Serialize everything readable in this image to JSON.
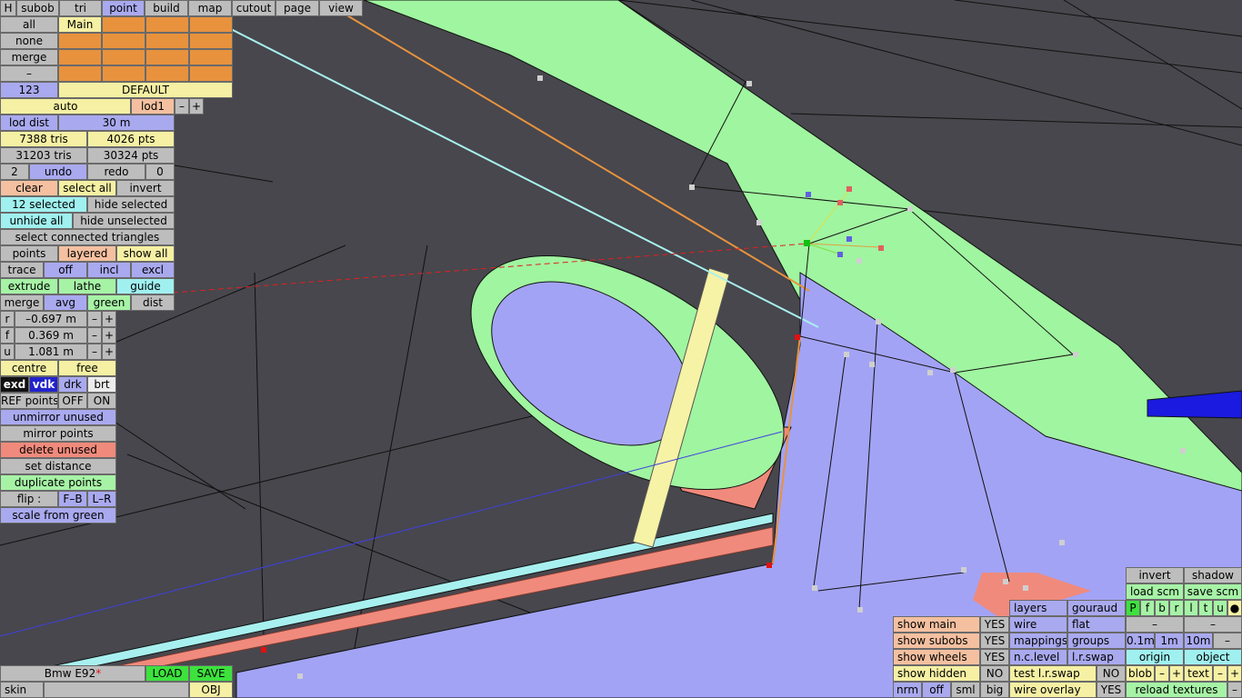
{
  "menu": {
    "h": "H",
    "tabs": [
      "subob",
      "tri",
      "point",
      "build",
      "map",
      "cutout",
      "page",
      "view"
    ],
    "active": "point"
  },
  "layers": {
    "all": "all",
    "none": "none",
    "merge": "merge",
    "dash": "–",
    "main": "Main",
    "num": "123",
    "default": "DEFAULT"
  },
  "lod": {
    "auto": "auto",
    "lod": "lod1",
    "minus": "–",
    "plus": "+",
    "dist_label": "lod dist",
    "dist_value": "30 m"
  },
  "stats": {
    "tris": "7388 tris",
    "pts": "4026 pts",
    "tris_total": "31203 tris",
    "pts_total": "30324 pts"
  },
  "history": {
    "count": "2",
    "undo": "undo",
    "redo": "redo",
    "redo_count": "0"
  },
  "selection": {
    "clear": "clear",
    "select_all": "select all",
    "invert": "invert",
    "selected": "12 selected",
    "hide_selected": "hide selected",
    "unhide_all": "unhide all",
    "hide_unselected": "hide unselected",
    "connected": "select connected triangles"
  },
  "display": {
    "points": "points",
    "layered": "layered",
    "show_all": "show all"
  },
  "trace": {
    "label": "trace",
    "off": "off",
    "incl": "incl",
    "excl": "excl"
  },
  "tools": {
    "extrude": "extrude",
    "lathe": "lathe",
    "guide": "guide"
  },
  "merge_row": {
    "merge": "merge",
    "avg": "avg",
    "green": "green",
    "dist": "dist"
  },
  "coords": [
    {
      "axis": "r",
      "value": "–0.697 m"
    },
    {
      "axis": "f",
      "value": "0.369 m"
    },
    {
      "axis": "u",
      "value": "1.081 m"
    }
  ],
  "stepper": {
    "minus": "–",
    "plus": "+"
  },
  "centre": {
    "centre": "centre",
    "free": "free"
  },
  "render_modes": [
    "exd",
    "vdk",
    "drk",
    "brt"
  ],
  "refpoints": {
    "label": "REF points",
    "off": "OFF",
    "on": "ON"
  },
  "actions": {
    "unmirror": "unmirror unused",
    "mirror": "mirror points",
    "delete": "delete unused",
    "set_distance": "set distance",
    "duplicate": "duplicate points",
    "flip": "flip :",
    "fb": "F–B",
    "lr": "L–R",
    "scale": "scale from green"
  },
  "file": {
    "name": "Bmw E92",
    "modified": "*",
    "load": "LOAD",
    "save": "SAVE",
    "skin": "skin",
    "obj": "OBJ"
  },
  "show": {
    "main": "show main",
    "main_v": "YES",
    "subobs": "show subobs",
    "subobs_v": "YES",
    "wheels": "show wheels",
    "wheels_v": "YES",
    "hidden": "show hidden",
    "hidden_v": "NO"
  },
  "normals": {
    "nrm": "nrm",
    "off": "off",
    "sml": "sml",
    "big": "big"
  },
  "shade": {
    "layers": "layers",
    "gouraud": "gouraud",
    "wire": "wire",
    "flat": "flat",
    "mappings": "mappings",
    "groups": "groups",
    "nclevel": "n.c.level",
    "lrswap": "l.r.swap",
    "test_lr": "test l.r.swap",
    "test_lr_v": "NO",
    "overlay": "wire overlay",
    "overlay_v": "YES"
  },
  "right": {
    "invert": "invert",
    "shadow": "shadow",
    "load_scm": "load scm",
    "save_scm": "save scm",
    "flags": [
      "P",
      "f",
      "b",
      "r",
      "l",
      "t",
      "u",
      "●"
    ],
    "dash": "–",
    "steps": [
      "0.1m",
      "1m",
      "10m",
      "–"
    ],
    "origin": "origin",
    "object": "object",
    "blob": "blob",
    "text": "text",
    "minus": "–",
    "plus": "+",
    "reload": "reload textures",
    "rminus": "–"
  },
  "colors": {
    "viewport_bg": "#47474d",
    "green_panel": "#a0f5a0",
    "blue_panel": "#a3a3f5",
    "salmon_panel": "#f08a7c",
    "yellow_panel": "#f6f2a6",
    "cyan_strip": "#a8f0f0",
    "dark_blue": "#1a1ae0"
  }
}
